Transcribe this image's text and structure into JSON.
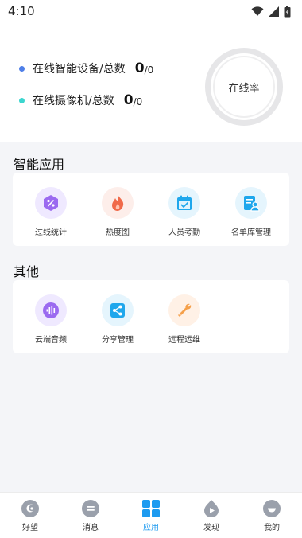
{
  "status_bar": {
    "time": "4:10"
  },
  "overview": {
    "devices": {
      "label": "在线智能设备/总数",
      "online": "0",
      "total": "/0",
      "color": "#4f7fe8"
    },
    "cameras": {
      "label": "在线摄像机/总数",
      "online": "0",
      "total": "/0",
      "color": "#3cd6cf"
    },
    "online_rate_label": "在线率"
  },
  "smart_apps": {
    "title": "智能应用",
    "items": [
      {
        "label": "过线统计",
        "icon": "percent-icon",
        "bg": "#efe9ff",
        "color": "#9b6af0"
      },
      {
        "label": "热度图",
        "icon": "flame-icon",
        "bg": "#fdeeea",
        "color": "#f06a4a"
      },
      {
        "label": "人员考勤",
        "icon": "calendar-check-icon",
        "bg": "#e5f5fd",
        "color": "#1fa7ec"
      },
      {
        "label": "名单库管理",
        "icon": "list-person-icon",
        "bg": "#e5f5fd",
        "color": "#1fa7ec"
      }
    ]
  },
  "other": {
    "title": "其他",
    "items": [
      {
        "label": "云端音频",
        "icon": "audio-wave-icon",
        "bg": "#efe9ff",
        "color": "#9b6af0"
      },
      {
        "label": "分享管理",
        "icon": "share-icon",
        "bg": "#e5f5fd",
        "color": "#1fa7ec"
      },
      {
        "label": "远程运维",
        "icon": "wrench-icon",
        "bg": "#fff1e6",
        "color": "#f5a04a"
      }
    ]
  },
  "tab_bar": {
    "items": [
      {
        "label": "好望",
        "icon": "haowang-icon"
      },
      {
        "label": "消息",
        "icon": "message-icon"
      },
      {
        "label": "应用",
        "icon": "apps-grid-icon",
        "active": true
      },
      {
        "label": "发现",
        "icon": "discover-icon"
      },
      {
        "label": "我的",
        "icon": "profile-icon"
      }
    ],
    "active_color": "#1e9bf0",
    "inactive_color": "#9aa0ab"
  }
}
